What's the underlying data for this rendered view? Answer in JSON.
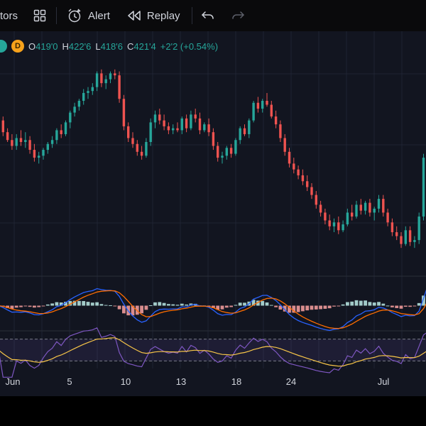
{
  "toolbar": {
    "indicators_label": "tors",
    "alert_label": "Alert",
    "replay_label": "Replay"
  },
  "legend": {
    "interval_badge": "D",
    "open_key": "O",
    "open_value": "419'0",
    "high_key": "H",
    "high_value": "422'6",
    "low_key": "L",
    "low_value": "418'6",
    "close_key": "C",
    "close_value": "421'4",
    "change": "+2'2 (+0.54%)"
  },
  "colors": {
    "up": "#26a69a",
    "down": "#ef5350",
    "macd": "#2962ff",
    "signal": "#ff6d00",
    "rsi": "#7e57c2",
    "rsi_ma": "#f7c548",
    "background": "#121520"
  },
  "chart_data": {
    "type": "candlestick",
    "x_tick_labels": [
      "Jun",
      "5",
      "10",
      "13",
      "18",
      "24",
      "Jul"
    ],
    "candles": [
      {
        "o": 412,
        "h": 416,
        "l": 408,
        "c": 409
      },
      {
        "o": 409,
        "h": 411,
        "l": 401,
        "c": 403
      },
      {
        "o": 403,
        "h": 405,
        "l": 398,
        "c": 399
      },
      {
        "o": 399,
        "h": 402,
        "l": 394,
        "c": 396
      },
      {
        "o": 396,
        "h": 402,
        "l": 394,
        "c": 400
      },
      {
        "o": 400,
        "h": 404,
        "l": 396,
        "c": 398
      },
      {
        "o": 398,
        "h": 403,
        "l": 395,
        "c": 399
      },
      {
        "o": 399,
        "h": 401,
        "l": 392,
        "c": 394
      },
      {
        "o": 394,
        "h": 397,
        "l": 388,
        "c": 390
      },
      {
        "o": 390,
        "h": 393,
        "l": 387,
        "c": 391
      },
      {
        "o": 391,
        "h": 395,
        "l": 389,
        "c": 394
      },
      {
        "o": 394,
        "h": 398,
        "l": 392,
        "c": 397
      },
      {
        "o": 397,
        "h": 401,
        "l": 395,
        "c": 399
      },
      {
        "o": 399,
        "h": 405,
        "l": 397,
        "c": 404
      },
      {
        "o": 404,
        "h": 407,
        "l": 400,
        "c": 402
      },
      {
        "o": 402,
        "h": 409,
        "l": 401,
        "c": 408
      },
      {
        "o": 408,
        "h": 414,
        "l": 405,
        "c": 413
      },
      {
        "o": 413,
        "h": 418,
        "l": 411,
        "c": 416
      },
      {
        "o": 416,
        "h": 420,
        "l": 414,
        "c": 419
      },
      {
        "o": 419,
        "h": 425,
        "l": 417,
        "c": 423
      },
      {
        "o": 423,
        "h": 426,
        "l": 420,
        "c": 424
      },
      {
        "o": 424,
        "h": 428,
        "l": 422,
        "c": 426
      },
      {
        "o": 426,
        "h": 434,
        "l": 424,
        "c": 433
      },
      {
        "o": 433,
        "h": 435,
        "l": 426,
        "c": 428
      },
      {
        "o": 428,
        "h": 432,
        "l": 425,
        "c": 430
      },
      {
        "o": 430,
        "h": 434,
        "l": 428,
        "c": 433
      },
      {
        "o": 433,
        "h": 435,
        "l": 430,
        "c": 432
      },
      {
        "o": 432,
        "h": 434,
        "l": 418,
        "c": 420
      },
      {
        "o": 420,
        "h": 422,
        "l": 404,
        "c": 406
      },
      {
        "o": 406,
        "h": 408,
        "l": 398,
        "c": 400
      },
      {
        "o": 400,
        "h": 403,
        "l": 395,
        "c": 397
      },
      {
        "o": 397,
        "h": 399,
        "l": 391,
        "c": 393
      },
      {
        "o": 393,
        "h": 396,
        "l": 389,
        "c": 391
      },
      {
        "o": 391,
        "h": 400,
        "l": 390,
        "c": 398
      },
      {
        "o": 398,
        "h": 410,
        "l": 396,
        "c": 408
      },
      {
        "o": 408,
        "h": 414,
        "l": 405,
        "c": 412
      },
      {
        "o": 412,
        "h": 415,
        "l": 407,
        "c": 409
      },
      {
        "o": 409,
        "h": 412,
        "l": 404,
        "c": 406
      },
      {
        "o": 406,
        "h": 408,
        "l": 402,
        "c": 404
      },
      {
        "o": 404,
        "h": 407,
        "l": 402,
        "c": 405
      },
      {
        "o": 405,
        "h": 408,
        "l": 403,
        "c": 404
      },
      {
        "o": 404,
        "h": 411,
        "l": 402,
        "c": 410
      },
      {
        "o": 410,
        "h": 412,
        "l": 403,
        "c": 405
      },
      {
        "o": 405,
        "h": 414,
        "l": 404,
        "c": 412
      },
      {
        "o": 412,
        "h": 415,
        "l": 408,
        "c": 410
      },
      {
        "o": 410,
        "h": 413,
        "l": 402,
        "c": 404
      },
      {
        "o": 404,
        "h": 408,
        "l": 403,
        "c": 407
      },
      {
        "o": 407,
        "h": 410,
        "l": 401,
        "c": 403
      },
      {
        "o": 403,
        "h": 405,
        "l": 394,
        "c": 396
      },
      {
        "o": 396,
        "h": 398,
        "l": 388,
        "c": 390
      },
      {
        "o": 390,
        "h": 393,
        "l": 387,
        "c": 391
      },
      {
        "o": 391,
        "h": 396,
        "l": 389,
        "c": 395
      },
      {
        "o": 395,
        "h": 397,
        "l": 390,
        "c": 392
      },
      {
        "o": 392,
        "h": 400,
        "l": 391,
        "c": 399
      },
      {
        "o": 399,
        "h": 406,
        "l": 397,
        "c": 405
      },
      {
        "o": 405,
        "h": 407,
        "l": 401,
        "c": 402
      },
      {
        "o": 402,
        "h": 410,
        "l": 400,
        "c": 409
      },
      {
        "o": 409,
        "h": 419,
        "l": 408,
        "c": 418
      },
      {
        "o": 418,
        "h": 421,
        "l": 413,
        "c": 415
      },
      {
        "o": 415,
        "h": 420,
        "l": 413,
        "c": 419
      },
      {
        "o": 419,
        "h": 423,
        "l": 416,
        "c": 417
      },
      {
        "o": 417,
        "h": 419,
        "l": 410,
        "c": 411
      },
      {
        "o": 411,
        "h": 414,
        "l": 405,
        "c": 407
      },
      {
        "o": 407,
        "h": 409,
        "l": 398,
        "c": 400
      },
      {
        "o": 400,
        "h": 402,
        "l": 391,
        "c": 393
      },
      {
        "o": 393,
        "h": 395,
        "l": 385,
        "c": 387
      },
      {
        "o": 387,
        "h": 390,
        "l": 382,
        "c": 384
      },
      {
        "o": 384,
        "h": 386,
        "l": 379,
        "c": 381
      },
      {
        "o": 381,
        "h": 384,
        "l": 376,
        "c": 378
      },
      {
        "o": 378,
        "h": 381,
        "l": 373,
        "c": 375
      },
      {
        "o": 375,
        "h": 377,
        "l": 369,
        "c": 371
      },
      {
        "o": 371,
        "h": 373,
        "l": 364,
        "c": 366
      },
      {
        "o": 366,
        "h": 368,
        "l": 360,
        "c": 362
      },
      {
        "o": 362,
        "h": 364,
        "l": 356,
        "c": 358
      },
      {
        "o": 358,
        "h": 361,
        "l": 353,
        "c": 355
      },
      {
        "o": 355,
        "h": 359,
        "l": 352,
        "c": 357
      },
      {
        "o": 357,
        "h": 360,
        "l": 351,
        "c": 353
      },
      {
        "o": 353,
        "h": 358,
        "l": 352,
        "c": 356
      },
      {
        "o": 356,
        "h": 364,
        "l": 355,
        "c": 362
      },
      {
        "o": 362,
        "h": 366,
        "l": 358,
        "c": 360
      },
      {
        "o": 360,
        "h": 368,
        "l": 359,
        "c": 366
      },
      {
        "o": 366,
        "h": 369,
        "l": 361,
        "c": 363
      },
      {
        "o": 363,
        "h": 368,
        "l": 361,
        "c": 367
      },
      {
        "o": 367,
        "h": 369,
        "l": 360,
        "c": 362
      },
      {
        "o": 362,
        "h": 365,
        "l": 358,
        "c": 364
      },
      {
        "o": 364,
        "h": 371,
        "l": 362,
        "c": 369
      },
      {
        "o": 369,
        "h": 371,
        "l": 360,
        "c": 362
      },
      {
        "o": 362,
        "h": 364,
        "l": 355,
        "c": 357
      },
      {
        "o": 357,
        "h": 359,
        "l": 350,
        "c": 352
      },
      {
        "o": 352,
        "h": 355,
        "l": 348,
        "c": 350
      },
      {
        "o": 350,
        "h": 352,
        "l": 344,
        "c": 346
      },
      {
        "o": 346,
        "h": 355,
        "l": 345,
        "c": 353
      },
      {
        "o": 353,
        "h": 355,
        "l": 345,
        "c": 347
      },
      {
        "o": 347,
        "h": 350,
        "l": 344,
        "c": 348
      },
      {
        "o": 348,
        "h": 362,
        "l": 346,
        "c": 360
      },
      {
        "o": 360,
        "h": 392,
        "l": 358,
        "c": 390
      },
      {
        "o": 390,
        "h": 412,
        "l": 388,
        "c": 410
      },
      {
        "o": 410,
        "h": 414,
        "l": 404,
        "c": 412
      }
    ],
    "price_range": [
      335,
      440
    ],
    "macd_range": [
      -10,
      10
    ],
    "rsi_range": [
      20,
      80
    ],
    "rsi_bands": [
      30,
      70
    ],
    "grid": "on"
  }
}
